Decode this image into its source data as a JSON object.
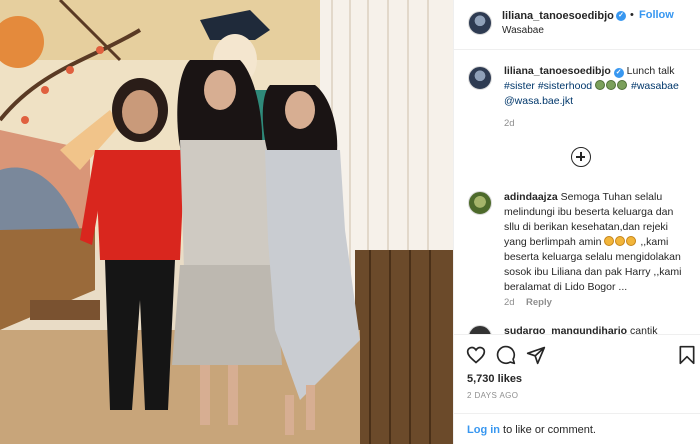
{
  "post": {
    "username": "liliana_tanoesoedibjo",
    "follow_label": "Follow",
    "separator": "•",
    "location": "Wasabae",
    "verified_glyph": "✓"
  },
  "caption": {
    "username": "liliana_tanoesoedibjo",
    "text": "Lunch talk",
    "line2": "#sister #sisterhood",
    "line2_tag": "#wasabae",
    "line3": "@wasa.bae.jkt",
    "time": "2d",
    "emoji_count": 3
  },
  "load_more": {
    "icon": "plus-circle-icon"
  },
  "comments": [
    {
      "username": "adindaajza",
      "lines": [
        "Semoga Tuhan selalu",
        "melindungi ibu beserta keluarga dan",
        "sllu di berikan kesehatan,dan rejeki",
        "yang berlimpah amin",
        "beserta keluarga selalu mengidolakan",
        "sosok ibu Liliana dan pak Harry ,,kami",
        "beralamat di Lido Bogor ..."
      ],
      "line4_tail": ",,kami",
      "time": "2d",
      "reply_label": "Reply"
    },
    {
      "username": "sudargo_mangundiharjo",
      "text": "cantik"
    }
  ],
  "actions": {
    "like_icon": "heart-icon",
    "comment_icon": "comment-icon",
    "share_icon": "share-icon",
    "save_icon": "bookmark-icon",
    "likes": "5,730 likes",
    "date": "2 days ago"
  },
  "login": {
    "link": "Log in",
    "text": " to like or comment."
  },
  "colors": {
    "accent": "#3897f0",
    "hashtag": "#00376b",
    "muted": "#8e8e8e"
  }
}
